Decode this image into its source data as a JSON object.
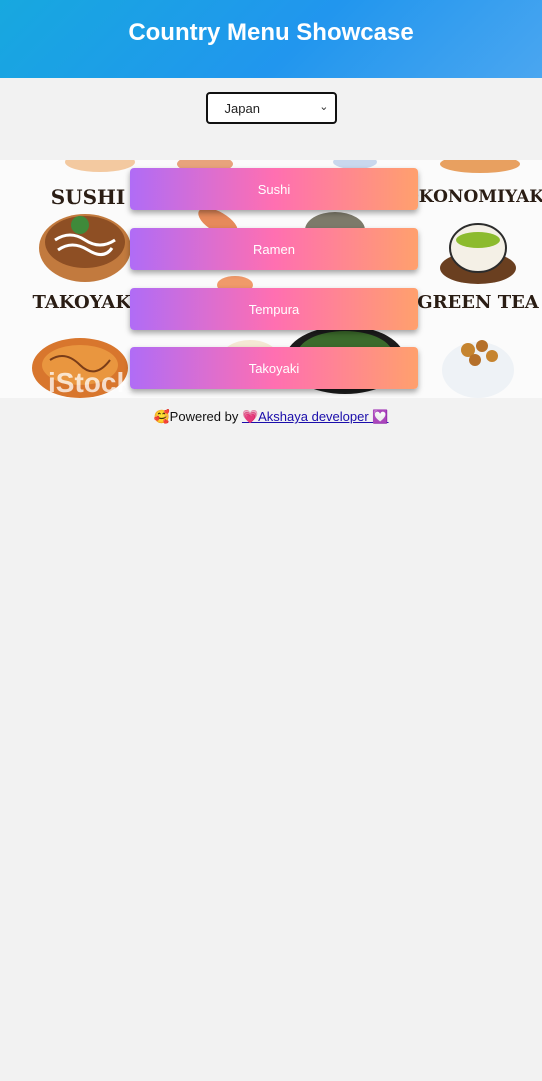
{
  "header": {
    "title": "Country Menu Showcase"
  },
  "country_select": {
    "selected": "Japan"
  },
  "banner": {
    "image_labels": [
      "SUSHI",
      "OKONOMIYAKI",
      "TAKOYAKI",
      "GREEN TEA"
    ],
    "watermark": "iStock"
  },
  "menu": {
    "items": [
      {
        "label": "Sushi"
      },
      {
        "label": "Ramen"
      },
      {
        "label": "Tempura"
      },
      {
        "label": "Takoyaki"
      }
    ]
  },
  "footer": {
    "prefix_emoji": "🥰",
    "powered_by": "Powered by ",
    "link_text": "💗Akshaya developer 💟"
  },
  "colors": {
    "header_gradient_start": "#17a8df",
    "header_gradient_end": "#4aa6f0",
    "button_gradient_start": "#b06cf6",
    "button_gradient_mid": "#ff6fb1",
    "button_gradient_end": "#ffa06d",
    "page_background": "#f2f2f2"
  }
}
